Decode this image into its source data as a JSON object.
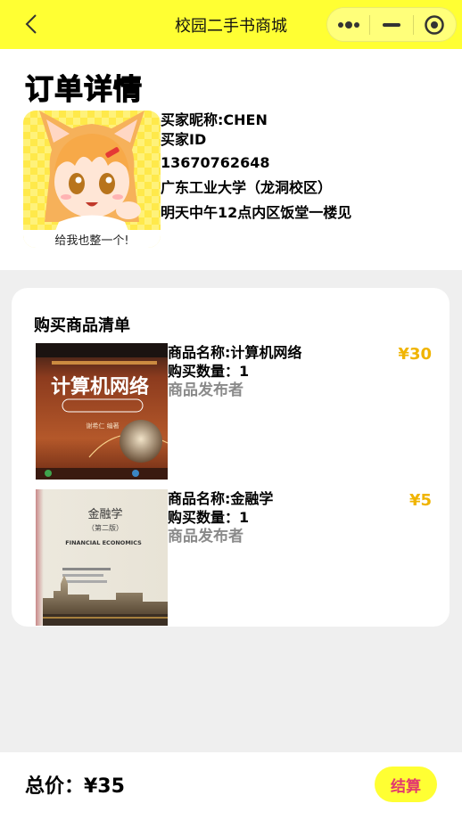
{
  "nav": {
    "title": "校园二手书商城"
  },
  "order": {
    "title": "订单详情"
  },
  "buyer": {
    "avatar_caption": "给我也整一个!",
    "nickname": "买家昵称:CHEN",
    "id_label": "买家ID",
    "phone": "13670762648",
    "school": "广东工业大学（龙洞校区）",
    "pickup": "明天中午12点内区饭堂一楼见"
  },
  "goods": {
    "heading": "购买商品清单",
    "items": [
      {
        "name": "商品名称:计算机网络",
        "count": "购买数量：1",
        "seller": "商品发布者",
        "price": "¥30",
        "cover_title": "计算机网络",
        "cover_author": "谢希仁 编著"
      },
      {
        "name": "商品名称:金融学",
        "count": "购买数量：1",
        "seller": "商品发布者",
        "price": "¥5",
        "cover_title": "金融学",
        "cover_subtitle": "（第二版）",
        "cover_english": "FINANCIAL ECONOMICS"
      }
    ]
  },
  "footer": {
    "total": "总价：¥35",
    "checkout": "结算"
  },
  "colors": {
    "brand_yellow": "#ffff33",
    "price": "#f0b400",
    "checkout_text": "#e2386f"
  }
}
